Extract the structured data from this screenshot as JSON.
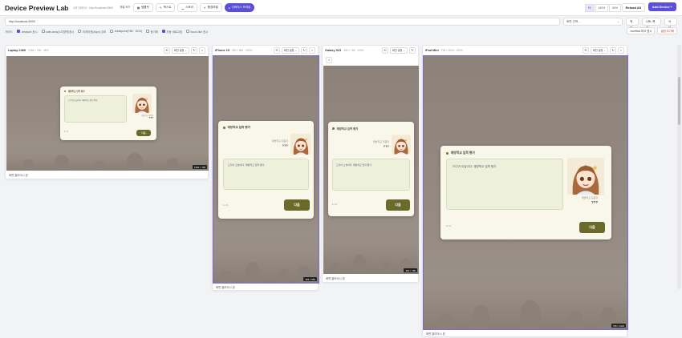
{
  "app": {
    "title": "Device Preview Lab",
    "subtitle": "4개 디바이스 · http://localhost:3000/",
    "mode_label": "개발 모드",
    "mode_buttons": [
      {
        "label": "템플릿",
        "icon": "grid-icon",
        "active": false
      },
      {
        "label": "텍스트",
        "icon": "pencil-icon",
        "active": false
      },
      {
        "label": "스토리",
        "icon": "chart-icon",
        "active": false
      },
      {
        "label": "풍경라벨",
        "icon": "brush-icon",
        "active": false
      },
      {
        "label": "디바이스 프리뷰",
        "icon": "circle-icon",
        "active": true
      }
    ],
    "zoom_options": [
      "Fit",
      "100%",
      "50%"
    ],
    "zoom_selected": "Fit",
    "reload_label": "Reload All",
    "add_device_label": "Add Device +"
  },
  "url_bar": {
    "value": "http://localhost:3000/",
    "preset_label": "화면 선택...",
    "apply_label": "적용",
    "url_share_label": "URL 복제",
    "delete_label": "삭제"
  },
  "options": {
    "label": "가이드:",
    "items": [
      {
        "label": "viewport 표시",
        "checked": true
      },
      {
        "label": "safe-area(노치영역)표시",
        "checked": false
      },
      {
        "label": "터치타겟(44px) 강조",
        "checked": false
      },
      {
        "label": "breakpoint(768 · 1024)",
        "checked": false
      },
      {
        "label": "동기화",
        "checked": false
      },
      {
        "label": "자동 새로고침",
        "checked": true
      },
      {
        "label": "touch-like 표시",
        "checked": false
      }
    ],
    "overflow_label": "overflow 마크 표시",
    "reset_label": "설정 초기화"
  },
  "common": {
    "dialog_title": "재방학교 입학 평가",
    "dialog_text": "드디어 오늘이다. 재방학교 입학 평가",
    "speaker_role": "재방학교 지원자",
    "speaker_name": "???",
    "page": "1 / 4",
    "next": "다음",
    "footer": "화면 클리어시 완",
    "rotate_select": "회전 설정"
  },
  "devices": [
    {
      "name": "Laptop 1366",
      "size": "1366 × 768 · 38%",
      "badge": "1366 × 768"
    },
    {
      "name": "iPhone 15",
      "size": "393 × 852 · 100%",
      "badge": "393 × 852"
    },
    {
      "name": "Galaxy S23",
      "size": "360 × 780 · 100%",
      "badge": "360 × 780"
    },
    {
      "name": "iPad Mini",
      "size": "768 × 1024 · 100%",
      "badge": "768 × 1024"
    }
  ],
  "colors": {
    "accent": "#5b4fd8",
    "next_button": "#6a6b2a",
    "dialog_bg": "#f9f6ea",
    "textbox_bg": "#edf1dc"
  }
}
